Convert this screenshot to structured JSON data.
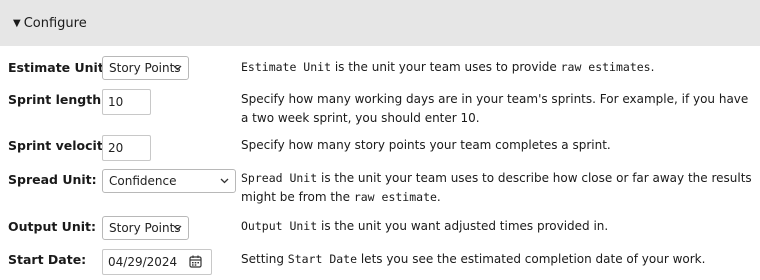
{
  "configure": {
    "summary_label": "Configure"
  },
  "fields": {
    "estimate_unit": {
      "label": "Estimate Unit:",
      "value": "Story Points",
      "desc_code1": "Estimate Unit",
      "desc_text1": " is the unit your team uses to provide ",
      "desc_code2": "raw estimates",
      "desc_text2": "."
    },
    "sprint_length": {
      "label": "Sprint length:",
      "value": "10",
      "desc": "Specify how many working days are in your team's sprints. For example, if you have a two week sprint, you should enter 10."
    },
    "sprint_velocity": {
      "label": "Sprint velocity:",
      "value": "20",
      "desc": "Specify how many story points your team completes a sprint."
    },
    "spread_unit": {
      "label": "Spread Unit:",
      "value": "Confidence",
      "desc_code1": "Spread Unit",
      "desc_text1": " is the unit your team uses to describe how close or far away the results might be from the ",
      "desc_code2": "raw estimate",
      "desc_text2": "."
    },
    "output_unit": {
      "label": "Output Unit:",
      "value": "Story Points",
      "desc_code1": "Output Unit",
      "desc_text1": " is the unit you want adjusted times provided in."
    },
    "start_date": {
      "label": "Start Date:",
      "value": "04/29/2024",
      "desc_text1": "Setting ",
      "desc_code1": "Start Date",
      "desc_text2": " lets you see the estimated completion date of your work."
    }
  },
  "icons": {
    "summary_toggle": "triangle-down",
    "select_chevron": "chevron-down",
    "date_picker": "calendar"
  }
}
